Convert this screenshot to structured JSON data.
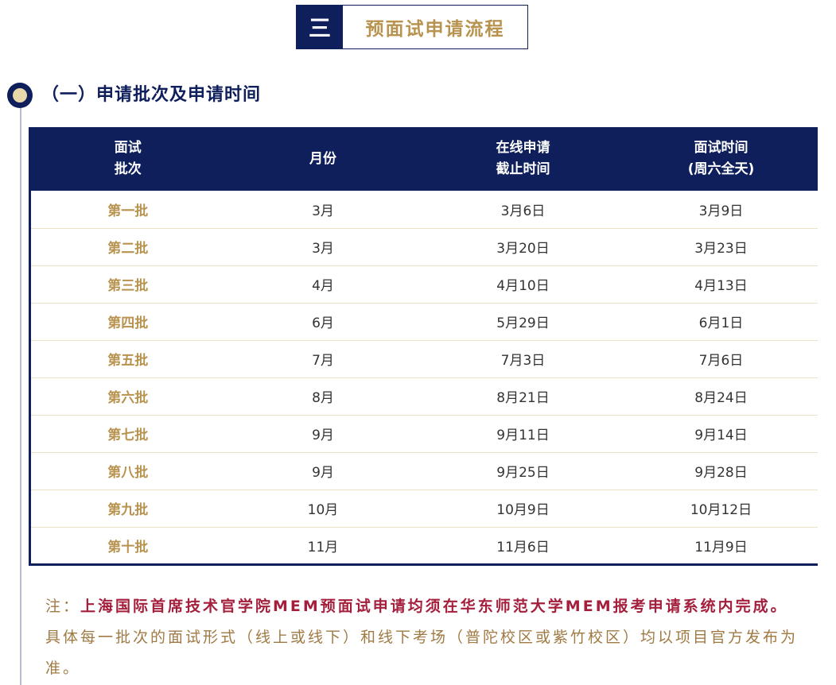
{
  "section": {
    "number": "三",
    "title": "预面试申请流程"
  },
  "subsection": {
    "title": "（一）申请批次及申请时间"
  },
  "table": {
    "headers": [
      [
        "面试",
        "批次"
      ],
      [
        "月份"
      ],
      [
        "在线申请",
        "截止时间"
      ],
      [
        "面试时间",
        "(周六全天)"
      ]
    ],
    "rows": [
      [
        "第一批",
        "3月",
        "3月6日",
        "3月9日"
      ],
      [
        "第二批",
        "3月",
        "3月20日",
        "3月23日"
      ],
      [
        "第三批",
        "4月",
        "4月10日",
        "4月13日"
      ],
      [
        "第四批",
        "6月",
        "5月29日",
        "6月1日"
      ],
      [
        "第五批",
        "7月",
        "7月3日",
        "7月6日"
      ],
      [
        "第六批",
        "8月",
        "8月21日",
        "8月24日"
      ],
      [
        "第七批",
        "9月",
        "9月11日",
        "9月14日"
      ],
      [
        "第八批",
        "9月",
        "9月25日",
        "9月28日"
      ],
      [
        "第九批",
        "10月",
        "10月9日",
        "10月12日"
      ],
      [
        "第十批",
        "11月",
        "11月6日",
        "11月9日"
      ]
    ]
  },
  "note": {
    "label": "注：",
    "strong": "上海国际首席技术官学院MEM预面试申请均须在华东师范大学MEM报考申请系统内完成。",
    "body": "具体每一批次的面试形式（线上或线下）和线下考场（普陀校区或紫竹校区）均以项目官方发布为准。"
  },
  "colors": {
    "navy": "#0e1f5b",
    "gold": "#b8934f",
    "red": "#a31f3c"
  }
}
